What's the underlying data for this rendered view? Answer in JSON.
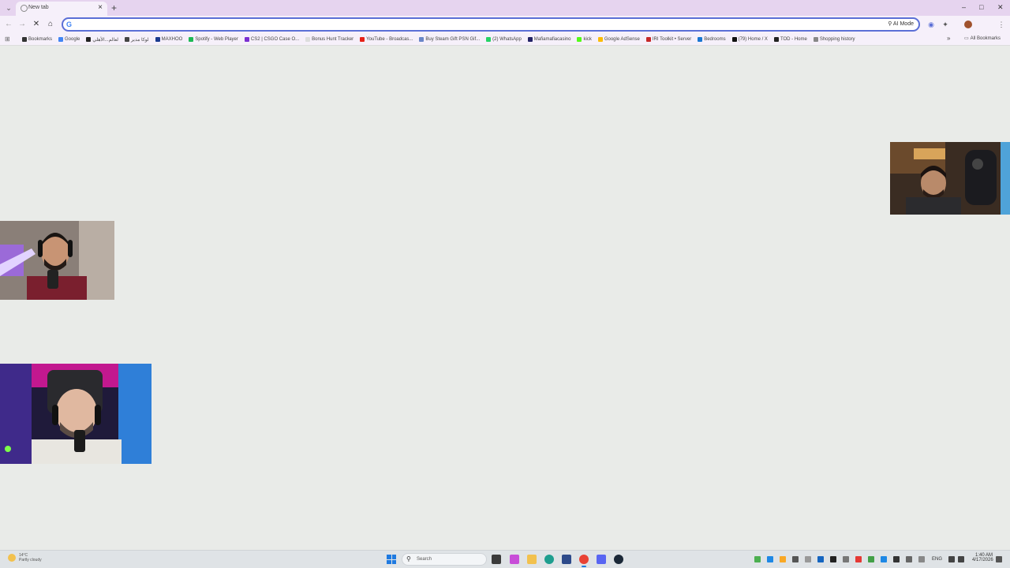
{
  "browser": {
    "tab": {
      "title": "New tab",
      "close": "×"
    },
    "new_tab": "+",
    "window_controls": {
      "minimize": "–",
      "maximize": "□",
      "close": "✕"
    },
    "omnibox": {
      "value": "",
      "placeholder": "",
      "ai_mode_label": "AI Mode"
    },
    "bookmarks": [
      {
        "label": "Bookmarks",
        "color": "#333333"
      },
      {
        "label": "Google",
        "color": "#4285f4"
      },
      {
        "label": "لعالم...الأهلي",
        "color": "#222222"
      },
      {
        "label": "لوكا مدير",
        "color": "#444444"
      },
      {
        "label": "MAXHOO",
        "color": "#1a3a8f"
      },
      {
        "label": "Spotify - Web Player",
        "color": "#1db954"
      },
      {
        "label": "CS2 | CSGO Case O...",
        "color": "#7b2fd1"
      },
      {
        "label": "Bonus Hunt Tracker",
        "color": "#dddddd"
      },
      {
        "label": "YouTube - Broadcas...",
        "color": "#e62117"
      },
      {
        "label": "Buy Steam Gift PSN Gif...",
        "color": "#6a86c8"
      },
      {
        "label": "(2) WhatsApp",
        "color": "#25d366"
      },
      {
        "label": "Mafiamafiacasino",
        "color": "#222266"
      },
      {
        "label": "kick",
        "color": "#53fc18"
      },
      {
        "label": "Google AdSense",
        "color": "#fbbc05"
      },
      {
        "label": "IRI Toolkit • Server",
        "color": "#c62828"
      },
      {
        "label": "Bedrooms",
        "color": "#1976d2"
      },
      {
        "label": "(79) Home / X",
        "color": "#111111"
      },
      {
        "label": "TOD - Home",
        "color": "#222222"
      },
      {
        "label": "Shopping history",
        "color": "#888888"
      }
    ],
    "bookmarks_more": "»",
    "all_bookmarks": "All Bookmarks"
  },
  "taskbar": {
    "weather": {
      "temp": "14°C",
      "desc": "Partly cloudy"
    },
    "search_label": "Search",
    "language": "ENG",
    "time": "1:40 AM",
    "date": "4/17/2026"
  },
  "colors": {
    "page_background": "#e9ebe8",
    "tab_strip": "#e6d4ef",
    "accent": "#5b6fd6"
  }
}
